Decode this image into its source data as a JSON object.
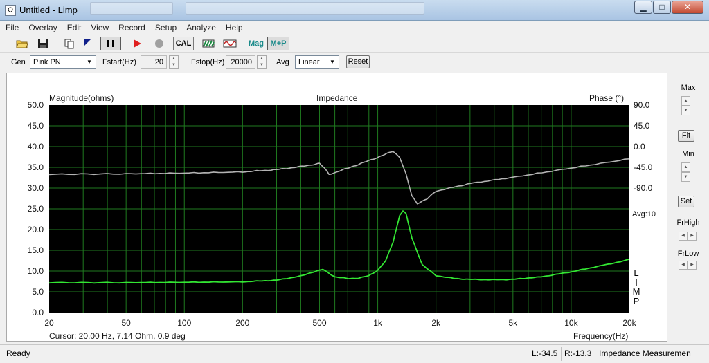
{
  "window": {
    "title": "Untitled - Limp",
    "app_icon": "Ω",
    "minimize_glyph": "▁",
    "maximize_glyph": "□",
    "close_glyph": "✕"
  },
  "menu": [
    "File",
    "Overlay",
    "Edit",
    "View",
    "Record",
    "Setup",
    "Analyze",
    "Help"
  ],
  "toolbar": {
    "cal_label": "CAL",
    "mag_label": "Mag",
    "mp_label": "M+P",
    "icons": [
      "open-folder-icon",
      "save-disk-icon",
      "copy-icon",
      "marker-icon",
      "pause-icon",
      "play-icon",
      "stop-icon",
      "cal-icon",
      "hatch-icon",
      "sine-icon"
    ],
    "colors": {
      "play": "#e02020",
      "stop": "#a0a0a0",
      "mag": "#1a8a8a"
    }
  },
  "generator": {
    "gen_label": "Gen",
    "gen_value": "Pink PN",
    "fstart_label": "Fstart(Hz)",
    "fstart_value": "20",
    "fstop_label": "Fstop(Hz)",
    "fstop_value": "20000",
    "avg_label": "Avg",
    "avg_value": "Linear",
    "reset_label": "Reset"
  },
  "graph": {
    "title": "Impedance",
    "left_axis_label": "Magnitude(ohms)",
    "right_axis_label": "Phase (°)",
    "x_axis_label": "Frequency(Hz)",
    "cursor_text": "Cursor: 20.00 Hz, 7.14 Ohm, 0.9 deg",
    "avg_text": "Avg:10",
    "vertical_tag": [
      "L",
      "I",
      "M",
      "P"
    ],
    "left_ticks": [
      "50.0",
      "45.0",
      "40.0",
      "35.0",
      "30.0",
      "25.0",
      "20.0",
      "15.0",
      "10.0",
      "5.0",
      "0.0"
    ],
    "right_ticks": [
      "90.0",
      "45.0",
      "0.0",
      "-45.0",
      "-90.0"
    ],
    "x_ticks": [
      "20",
      "50",
      "100",
      "200",
      "500",
      "1k",
      "2k",
      "5k",
      "10k",
      "20k"
    ],
    "colors": {
      "background": "#000000",
      "grid": "#1f7a1f",
      "magnitude": "#33e633",
      "phase": "#b4b4b4"
    }
  },
  "chart_data": {
    "type": "line",
    "title": "Impedance",
    "xlabel": "Frequency(Hz)",
    "ylabel": "Magnitude(ohms)",
    "y2label": "Phase (°)",
    "xscale": "log",
    "xlim": [
      20,
      20000
    ],
    "ylim": [
      0,
      50
    ],
    "y2lim": [
      -180,
      90
    ],
    "grid": true,
    "series": [
      {
        "axis": "left",
        "color": "#33e633",
        "x": [
          20,
          50,
          100,
          200,
          300,
          400,
          450,
          520,
          550,
          600,
          700,
          800,
          900,
          1000,
          1100,
          1200,
          1300,
          1350,
          1400,
          1500,
          1700,
          2000,
          2500,
          3000,
          4000,
          5000,
          7000,
          10000,
          15000,
          19000,
          20000
        ],
        "y": [
          7.2,
          7.2,
          7.3,
          7.4,
          7.8,
          8.8,
          9.6,
          10.4,
          9.7,
          8.6,
          8.2,
          8.3,
          8.9,
          10.2,
          12.5,
          17.0,
          23.5,
          24.5,
          23.8,
          18.0,
          11.5,
          8.9,
          8.2,
          8.0,
          7.9,
          8.0,
          8.6,
          9.8,
          11.5,
          12.5,
          12.9
        ]
      },
      {
        "axis": "right",
        "color": "#b4b4b4",
        "x": [
          20,
          50,
          100,
          200,
          300,
          400,
          500,
          530,
          560,
          600,
          700,
          800,
          1000,
          1200,
          1300,
          1400,
          1500,
          1600,
          1800,
          2000,
          3000,
          5000,
          10000,
          20000
        ],
        "y": [
          0,
          0.5,
          1.5,
          3,
          6,
          10,
          14,
          8,
          0,
          2,
          8,
          13,
          22,
          30,
          22,
          0,
          -28,
          -38,
          -32,
          -22,
          -12,
          -4,
          8,
          20
        ]
      }
    ]
  },
  "right_panel": {
    "max_label": "Max",
    "fit_label": "Fit",
    "min_label": "Min",
    "set_label": "Set",
    "frhigh_label": "FrHigh",
    "frlow_label": "FrLow"
  },
  "status": {
    "ready": "Ready",
    "l_value": "L:-34.5",
    "r_value": "R:-13.3",
    "mode": "Impedance Measuremen"
  }
}
